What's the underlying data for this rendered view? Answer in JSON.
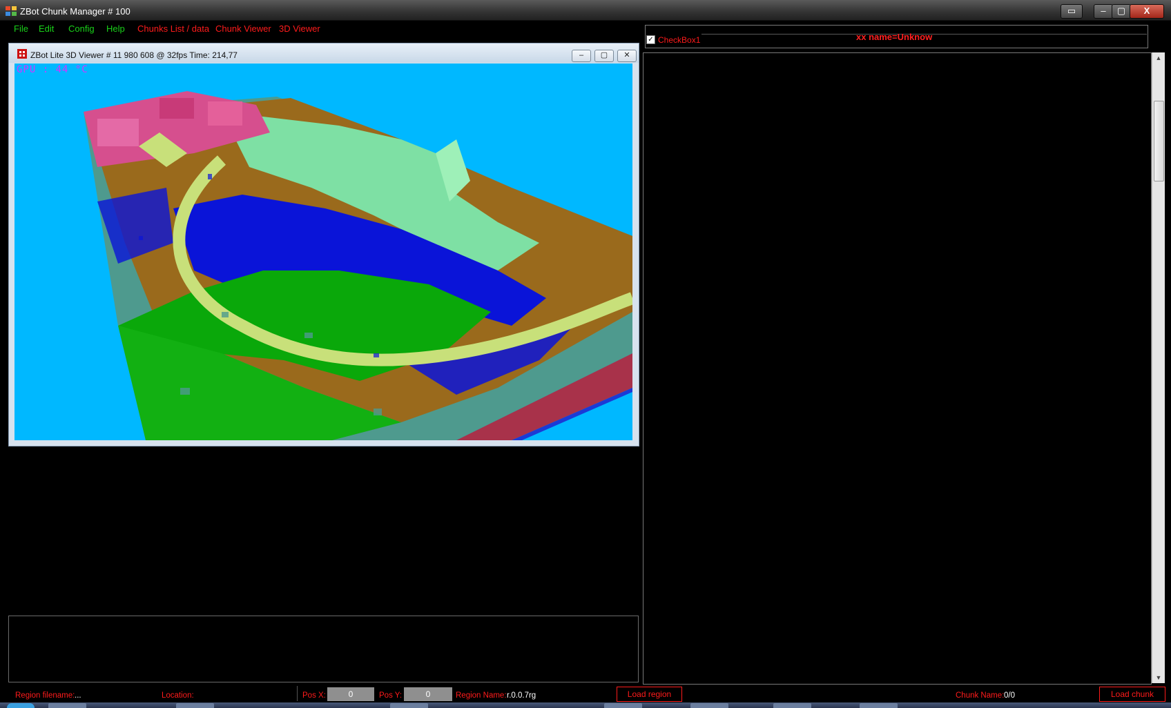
{
  "window": {
    "title": "ZBot Chunk Manager # 100",
    "buttons": {
      "restore_all": "▭",
      "minimize": "–",
      "maximize": "▢",
      "close": "X"
    }
  },
  "menu": {
    "items": [
      {
        "label": "File",
        "color": "#19d219"
      },
      {
        "label": "Edit",
        "color": "#19d219"
      },
      {
        "label": "Config",
        "color": "#19d219"
      },
      {
        "label": "Help",
        "color": "#19d219"
      },
      {
        "label": "Chunks List / data",
        "color": "#ff1b1b"
      },
      {
        "label": "Chunk Viewer",
        "color": "#ff1b1b"
      },
      {
        "label": "3D Viewer",
        "color": "#ff1b1b"
      }
    ]
  },
  "viewer": {
    "title": "ZBot Lite 3D Viewer # 11 980 608 @ 32fps Time: 214,77",
    "gpu_overlay": "GPU  :  44 °C",
    "buttons": {
      "minimize": "–",
      "maximize": "▢",
      "close": "✕"
    },
    "colors": {
      "sky": "#00b8ff",
      "grass": "#0aa80a",
      "water": "#0a14d8",
      "dirt": "#9a6a1c",
      "path": "#c8e07a",
      "wall": "#a8324a"
    }
  },
  "right_panel": {
    "checkbox_label": "CheckBox1",
    "checkbox_checked": true,
    "name_label": "xx name=Unknow"
  },
  "status": {
    "region_filename_label": "Region filename:",
    "region_filename_value": "...",
    "location_label": "Location:",
    "pos_x_label": "Pos X:",
    "pos_x_value": "0",
    "pos_y_label": "Pos Y:",
    "pos_y_value": "0",
    "region_name_label": "Region Name:",
    "region_name_value": "r.0.0.7rg",
    "load_region_label": "Load region",
    "chunk_name_label": "Chunk Name:",
    "chunk_name_value": "0/0",
    "load_chunk_label": "Load chunk"
  }
}
